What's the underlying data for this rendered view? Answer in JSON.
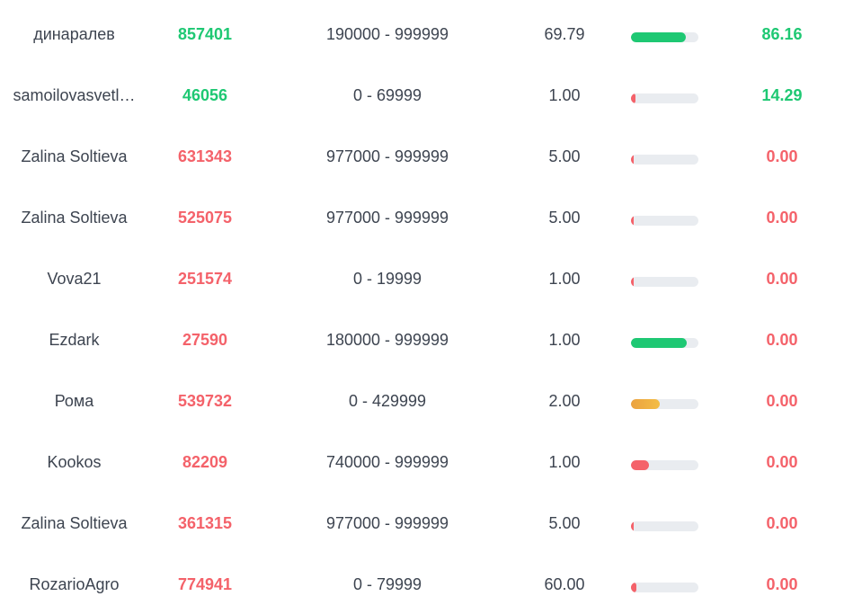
{
  "colors": {
    "win": "#1ec873",
    "loss": "#f4626a",
    "medium": "#f0a93e",
    "text": "#3d4450",
    "track": "#e9ecf0"
  },
  "rows": [
    {
      "user": "динаралев",
      "bet_id": "857401",
      "range": "190000 - 999999",
      "multiplier": "69.79",
      "chance_fraction": 0.82,
      "chance_level": "win",
      "payout": "86.16",
      "outcome": "win"
    },
    {
      "user": "samoilovasvetl…",
      "bet_id": "46056",
      "range": "0 - 69999",
      "multiplier": "1.00",
      "chance_fraction": 0.07,
      "chance_level": "loss",
      "payout": "14.29",
      "outcome": "win"
    },
    {
      "user": "Zalina Soltieva",
      "bet_id": "631343",
      "range": "977000 - 999999",
      "multiplier": "5.00",
      "chance_fraction": 0.02,
      "chance_level": "loss",
      "payout": "0.00",
      "outcome": "loss"
    },
    {
      "user": "Zalina Soltieva",
      "bet_id": "525075",
      "range": "977000 - 999999",
      "multiplier": "5.00",
      "chance_fraction": 0.02,
      "chance_level": "loss",
      "payout": "0.00",
      "outcome": "loss"
    },
    {
      "user": "Vova21",
      "bet_id": "251574",
      "range": "0 - 19999",
      "multiplier": "1.00",
      "chance_fraction": 0.02,
      "chance_level": "loss",
      "payout": "0.00",
      "outcome": "loss"
    },
    {
      "user": "Ezdark",
      "bet_id": "27590",
      "range": "180000 - 999999",
      "multiplier": "1.00",
      "chance_fraction": 0.83,
      "chance_level": "win",
      "payout": "0.00",
      "outcome": "loss"
    },
    {
      "user": "Рома",
      "bet_id": "539732",
      "range": "0 - 429999",
      "multiplier": "2.00",
      "chance_fraction": 0.43,
      "chance_level": "medium",
      "payout": "0.00",
      "outcome": "loss"
    },
    {
      "user": "Kookos",
      "bet_id": "82209",
      "range": "740000 - 999999",
      "multiplier": "1.00",
      "chance_fraction": 0.26,
      "chance_level": "loss",
      "payout": "0.00",
      "outcome": "loss"
    },
    {
      "user": "Zalina Soltieva",
      "bet_id": "361315",
      "range": "977000 - 999999",
      "multiplier": "5.00",
      "chance_fraction": 0.02,
      "chance_level": "loss",
      "payout": "0.00",
      "outcome": "loss"
    },
    {
      "user": "RozarioAgro",
      "bet_id": "774941",
      "range": "0 - 79999",
      "multiplier": "60.00",
      "chance_fraction": 0.08,
      "chance_level": "loss",
      "payout": "0.00",
      "outcome": "loss"
    }
  ]
}
